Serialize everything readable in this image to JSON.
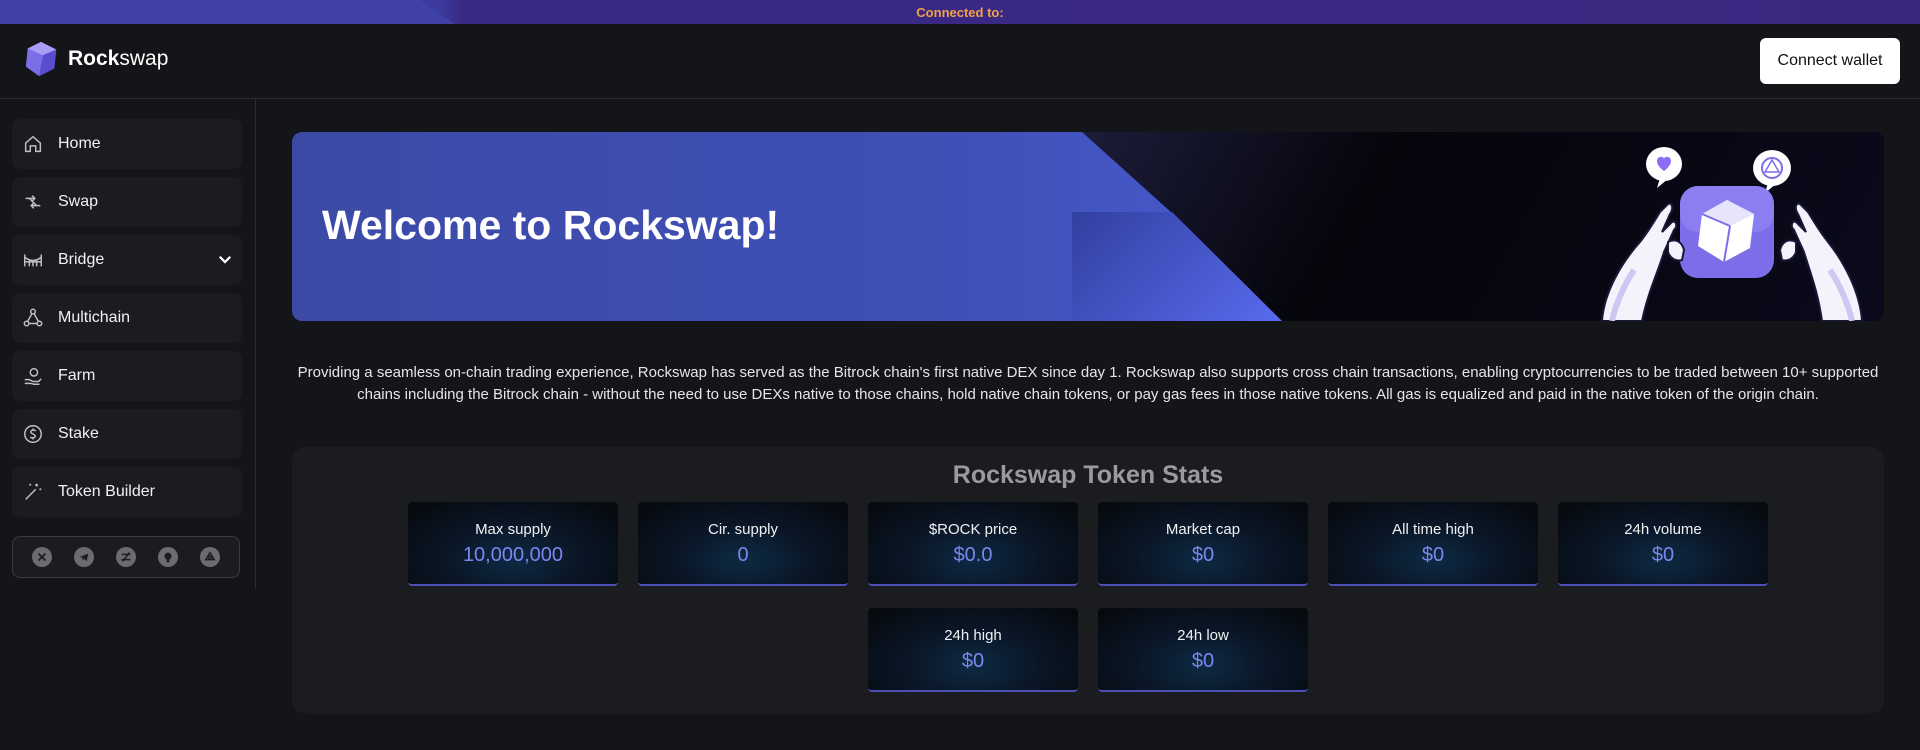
{
  "banner": {
    "text": "Connected to:"
  },
  "header": {
    "logo_bold": "Rock",
    "logo_rest": "swap",
    "connect_label": "Connect wallet"
  },
  "sidebar": {
    "items": [
      {
        "label": "Home",
        "icon": "home-icon"
      },
      {
        "label": "Swap",
        "icon": "swap-icon"
      },
      {
        "label": "Bridge",
        "icon": "bridge-icon"
      },
      {
        "label": "Multichain",
        "icon": "multichain-icon"
      },
      {
        "label": "Farm",
        "icon": "farm-icon"
      },
      {
        "label": "Stake",
        "icon": "stake-icon"
      },
      {
        "label": "Token Builder",
        "icon": "magic-wand-icon"
      }
    ],
    "socials": [
      "x-icon",
      "telegram-icon",
      "coingecko-icon",
      "github-icon",
      "coin-icon"
    ]
  },
  "hero": {
    "title": "Welcome to Rockswap!"
  },
  "description": "Providing a seamless on-chain trading experience, Rockswap has served as the Bitrock chain's first native DEX since day 1. Rockswap also supports cross chain transactions, enabling cryptocurrencies to be traded between 10+ supported chains including the Bitrock chain - without the need to use DEXs native to those chains, hold native chain tokens, or pay gas fees in those native tokens. All gas is equalized and paid in the native token of the origin chain.",
  "stats": {
    "title": "Rockswap Token Stats",
    "cards": [
      {
        "label": "Max supply",
        "value": "10,000,000"
      },
      {
        "label": "Cir. supply",
        "value": "0"
      },
      {
        "label": "$ROCK price",
        "value": "$0.0"
      },
      {
        "label": "Market cap",
        "value": "$0"
      },
      {
        "label": "All time high",
        "value": "$0"
      },
      {
        "label": "24h volume",
        "value": "$0"
      },
      {
        "label": "24h high",
        "value": "$0"
      },
      {
        "label": "24h low",
        "value": "$0"
      }
    ]
  },
  "colors": {
    "accent": "#7f85ef",
    "banner_text": "#f0a046",
    "background": "#141518",
    "card_border": "#4b4fb6"
  }
}
